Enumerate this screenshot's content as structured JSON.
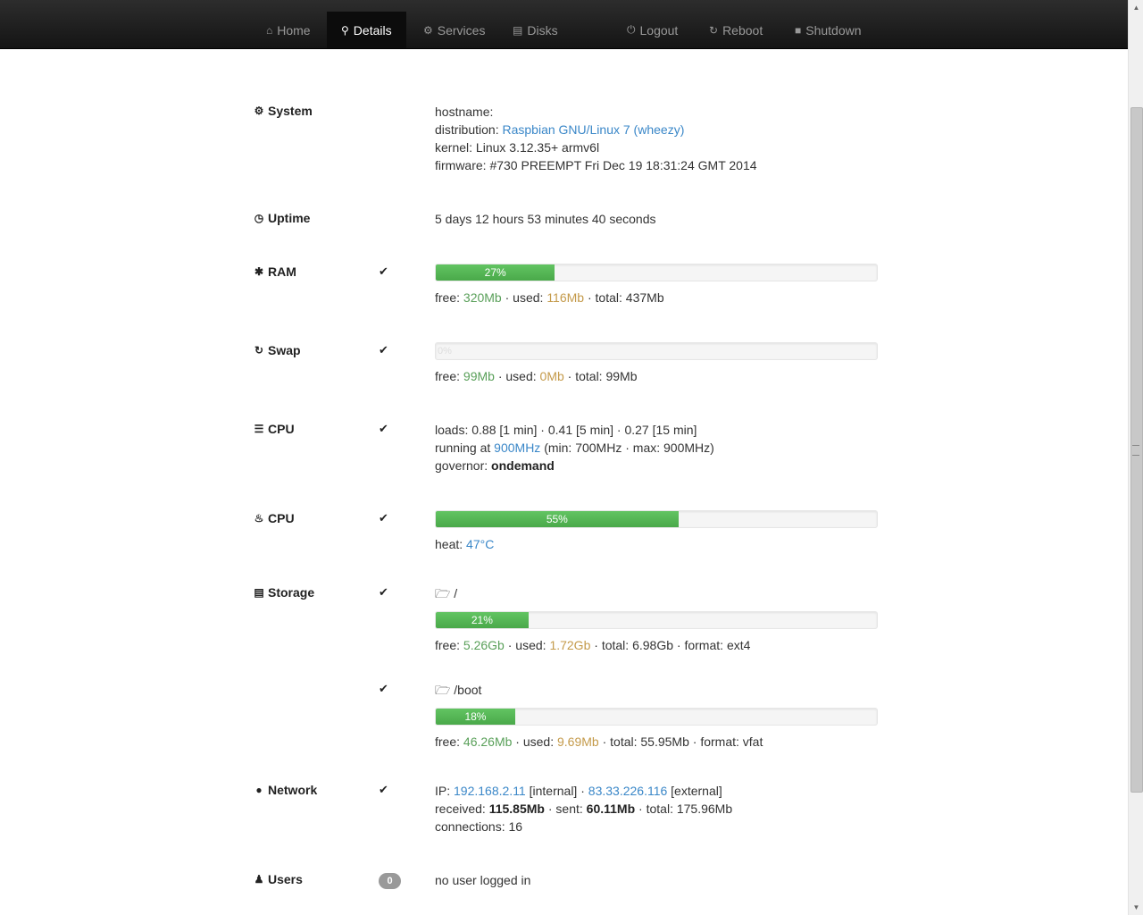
{
  "nav": {
    "home": {
      "label": "Home",
      "icon": "home-icon"
    },
    "details": {
      "label": "Details",
      "icon": "search-icon"
    },
    "services": {
      "label": "Services",
      "icon": "gear-icon"
    },
    "disks": {
      "label": "Disks",
      "icon": "hdd-icon"
    },
    "logout": {
      "label": "Logout",
      "icon": "power-icon"
    },
    "reboot": {
      "label": "Reboot",
      "icon": "refresh-icon"
    },
    "shutdown": {
      "label": "Shutdown",
      "icon": "stop-icon"
    },
    "active": "Details"
  },
  "system": {
    "label": "System",
    "hostname_label": "hostname:",
    "distribution_label": "distribution:",
    "distribution": "Raspbian GNU/Linux 7 (wheezy)",
    "kernel_label": "kernel:",
    "kernel": "Linux 3.12.35+ armv6l",
    "firmware_label": "firmware:",
    "firmware": "#730 PREEMPT Fri Dec 19 18:31:24 GMT 2014"
  },
  "uptime": {
    "label": "Uptime",
    "value": "5 days 12 hours 53 minutes 40 seconds"
  },
  "ram": {
    "label": "RAM",
    "percent": 27,
    "percent_text": "27%",
    "free_label": "free:",
    "free": "320Mb",
    "used_label": "used:",
    "used": "116Mb",
    "total_label": "total:",
    "total": "437Mb"
  },
  "swap": {
    "label": "Swap",
    "percent": 0,
    "percent_text": "0%",
    "free_label": "free:",
    "free": "99Mb",
    "used_label": "used:",
    "used": "0Mb",
    "total_label": "total:",
    "total": "99Mb"
  },
  "cpu": {
    "label": "CPU",
    "loads_label": "loads:",
    "load1": "0.88",
    "load1_unit": "[1 min]",
    "load5": "0.41",
    "load5_unit": "[5 min]",
    "load15": "0.27",
    "load15_unit": "[15 min]",
    "running_label": "running at",
    "freq": "900MHz",
    "minmax": "(min: 700MHz · max: 900MHz)",
    "governor_label": "governor:",
    "governor": "ondemand"
  },
  "cpu_heat": {
    "label": "CPU",
    "percent": 55,
    "percent_text": "55%",
    "heat_label": "heat:",
    "heat": "47°C"
  },
  "storage": {
    "label": "Storage",
    "disks": [
      {
        "mount": "/",
        "percent": 21,
        "percent_text": "21%",
        "free": "5.26Gb",
        "used": "1.72Gb",
        "total": "6.98Gb",
        "format": "ext4"
      },
      {
        "mount": "/boot",
        "percent": 18,
        "percent_text": "18%",
        "free": "46.26Mb",
        "used": "9.69Mb",
        "total": "55.95Mb",
        "format": "vfat"
      }
    ],
    "free_label": "free:",
    "used_label": "used:",
    "total_label": "total:",
    "format_label": "format:"
  },
  "network": {
    "label": "Network",
    "ip_label": "IP:",
    "ip_internal": "192.168.2.11",
    "internal_tag": "[internal]",
    "ip_external": "83.33.226.116",
    "external_tag": "[external]",
    "received_label": "received:",
    "received": "115.85Mb",
    "sent_label": "sent:",
    "sent": "60.11Mb",
    "total_label": "total:",
    "total": "175.96Mb",
    "connections_label": "connections:",
    "connections": "16"
  },
  "users": {
    "label": "Users",
    "count": "0",
    "message": "no user logged in"
  },
  "sep": "·"
}
